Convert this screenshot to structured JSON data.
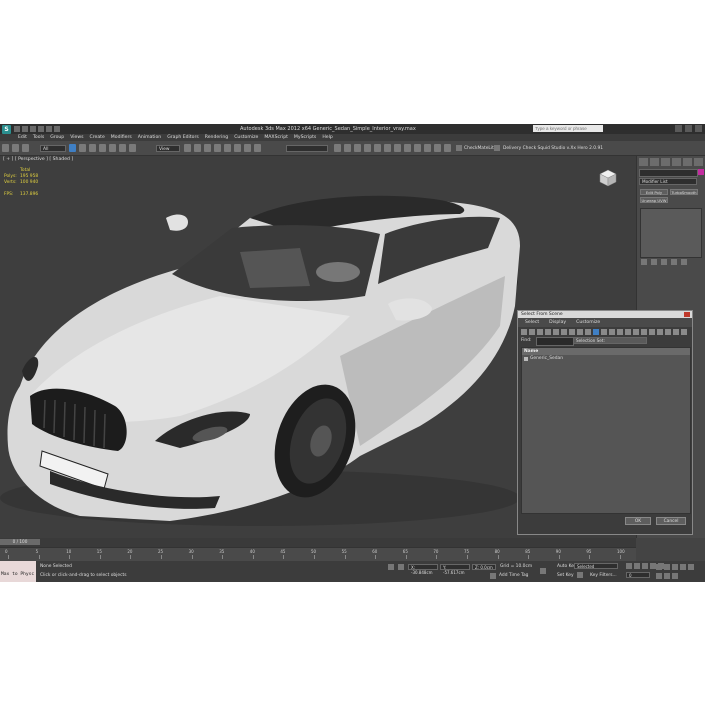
{
  "window": {
    "title": "Autodesk 3ds Max 2012 x64     Generic_Sedan_Simple_Interior_vray.max",
    "search_placeholder": "Type a keyword or phrase"
  },
  "menu": [
    "Edit",
    "Tools",
    "Group",
    "Views",
    "Create",
    "Modifiers",
    "Animation",
    "Graph Editors",
    "Rendering",
    "Customize",
    "MAXScript",
    "MyScripts",
    "Help"
  ],
  "toolbar": {
    "selection_filter": "All",
    "reference_coord": "View",
    "named_selection": "",
    "plugin_label": "CheckMateLite",
    "studio_label": "Delivery Check Squid Studio v.Xx Hero 2.0.91"
  },
  "viewport": {
    "label": "[ + ] [ Perspective ] [ Shaded ]",
    "stats_header": "Total",
    "stats": [
      {
        "key": "Polys:",
        "value": "195 958"
      },
      {
        "key": "Verts:",
        "value": "100 940"
      },
      {
        "key": "FPS:",
        "value": "137.896"
      }
    ]
  },
  "command_panel": {
    "modifier_list": "Modifier List",
    "buttons": [
      "Edit Poly",
      "TurboSmooth",
      "Unwrap UVW"
    ]
  },
  "dialog": {
    "title": "Select From Scene",
    "menu": [
      "Select",
      "Display",
      "Customize"
    ],
    "find_label": "Find:",
    "selection_set": "Selection Set:",
    "column_name": "Name",
    "items": [
      "Generic_Sedan"
    ],
    "ok": "OK",
    "cancel": "Cancel"
  },
  "timeline": {
    "slider_label": "0 / 100",
    "ticks": [
      "0",
      "5",
      "10",
      "15",
      "20",
      "25",
      "30",
      "35",
      "40",
      "45",
      "50",
      "55",
      "60",
      "65",
      "70",
      "75",
      "80",
      "85",
      "90",
      "95",
      "100"
    ]
  },
  "status": {
    "maxscript": "Max to Physc",
    "line1": "None Selected",
    "line2": "Click or click-and-drag to select objects",
    "x": "X: -30.848cm",
    "y": "Y: -57.617cm",
    "z": "Z: 0.0cm",
    "grid": "Grid = 10.0cm",
    "add_time_tag": "Add Time Tag",
    "auto_key": "Auto Key",
    "selected": "Selected",
    "set_key": "Set Key",
    "key_filters": "Key Filters...",
    "frame": "0"
  },
  "colors": {
    "accent": "#3f7fc4",
    "stats_text": "#e0d040",
    "object_color": "#c42ca0"
  }
}
